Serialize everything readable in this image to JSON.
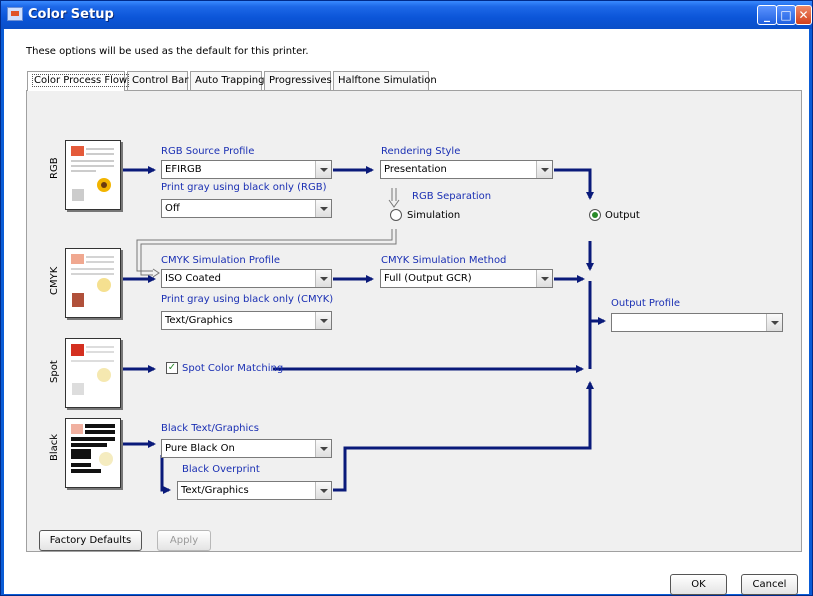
{
  "window": {
    "title": "Color Setup"
  },
  "hint": "These options will be used as the default for this printer.",
  "tabs": [
    {
      "label": "Color Process Flow"
    },
    {
      "label": "Control Bar"
    },
    {
      "label": "Auto Trapping"
    },
    {
      "label": "Progressives"
    },
    {
      "label": "Halftone Simulation"
    }
  ],
  "rows": {
    "rgb": "RGB",
    "cmyk": "CMYK",
    "spot": "Spot",
    "black": "Black"
  },
  "rgb_source": {
    "label": "RGB Source Profile",
    "value": "EFIRGB"
  },
  "rgb_gray": {
    "label": "Print gray using black only (RGB)",
    "value": "Off"
  },
  "rendering": {
    "label": "Rendering Style",
    "value": "Presentation"
  },
  "rgb_separation": {
    "label": "RGB Separation",
    "options": [
      {
        "label": "Simulation",
        "selected": false
      },
      {
        "label": "Output",
        "selected": true
      }
    ]
  },
  "cmyk_profile": {
    "label": "CMYK Simulation Profile",
    "value": "ISO Coated"
  },
  "cmyk_method": {
    "label": "CMYK Simulation Method",
    "value": "Full (Output GCR)"
  },
  "cmyk_gray": {
    "label": "Print gray using black only (CMYK)",
    "value": "Text/Graphics"
  },
  "output_profile": {
    "label": "Output Profile",
    "value": ""
  },
  "spot": {
    "label": "Spot Color Matching",
    "checked": true
  },
  "black_text": {
    "label": "Black Text/Graphics",
    "value": "Pure Black On"
  },
  "black_overprint": {
    "label": "Black Overprint",
    "value": "Text/Graphics"
  },
  "buttons": {
    "factory": "Factory Defaults",
    "apply": "Apply",
    "ok": "OK",
    "cancel": "Cancel"
  },
  "colors": {
    "flow": "#0a1a7a",
    "title_bar": "#0b55d8",
    "label": "#1a2fb3"
  }
}
